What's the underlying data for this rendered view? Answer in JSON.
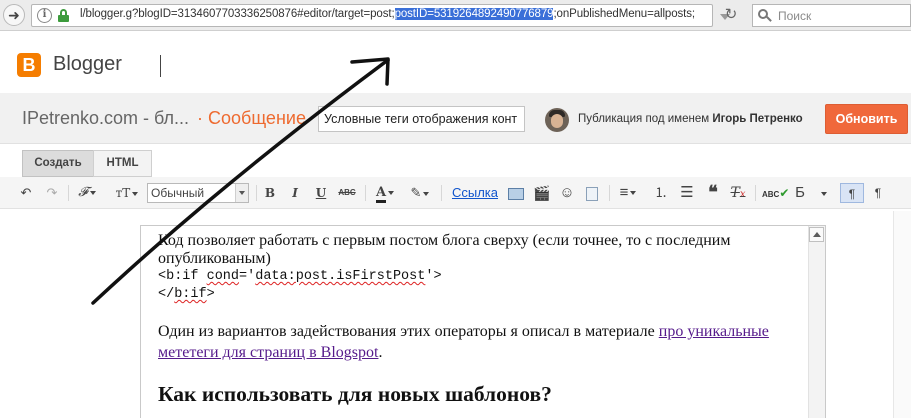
{
  "browser": {
    "url_before": "l/blogger.g?blogID=3134607703336250876#editor/target=post;",
    "url_selected": "postID=5319264892490776879",
    "url_after": ";onPublishedMenu=allposts;",
    "search_placeholder": "Поиск"
  },
  "header": {
    "logo_letter": "B",
    "brand": "Blogger"
  },
  "post_bar": {
    "blog_title": "IPetrenko.com - бл...",
    "post_kind": "· Сообщение",
    "post_title_value": "Условные теги отображения конт",
    "publishing_as_label": "Публикация под именем",
    "author_name": "Игорь Петренко",
    "publish_button": "Обновить"
  },
  "mode_tabs": {
    "compose": "Создать",
    "html": "HTML"
  },
  "toolbar": {
    "font_select": "Обычный",
    "font_icon": "𝓕",
    "size_icon": "тT",
    "bold": "B",
    "italic": "I",
    "underline": "U",
    "strike": "ABC",
    "text_color": "A",
    "link": "Ссылка",
    "spell_label": "Б",
    "pilcrow": "¶",
    "pilcrow_ltr": "¶"
  },
  "editor": {
    "para1": "Код позволяет работать с первым постом блога сверху (если точнее, то с последним опубликованым)",
    "code_line1_pre": "<b:if ",
    "code_line1_spell1": "cond",
    "code_line1_mid": "='",
    "code_line1_spell2": "data:post.isFirstPost",
    "code_line1_post": "'>",
    "code_line2_pre": "</",
    "code_line2_spell": "b:if",
    "code_line2_post": ">",
    "para2_text": "Один из вариантов задействования этих операторы я описал в материале ",
    "para2_link": "про уникальные мететеги для страниц в Blogspot",
    "para2_end": ".",
    "heading": "Как использовать для новых шаблонов?"
  }
}
